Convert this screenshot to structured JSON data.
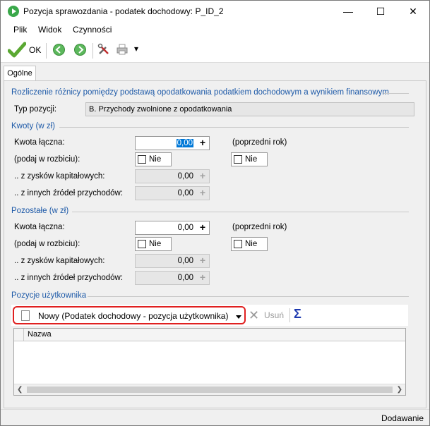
{
  "window": {
    "title": "Pozycja sprawozdania - podatek dochodowy: P_ID_2",
    "minimize": "—",
    "maximize": "☐",
    "close": "✕"
  },
  "menu": [
    "Plik",
    "Widok",
    "Czynności"
  ],
  "toolbar": {
    "ok_label": "OK",
    "dropdown_arrow": "▾"
  },
  "tabs": [
    "Ogólne"
  ],
  "header_section": {
    "title": "Rozliczenie różnicy pomiędzy podstawą opodatkowania podatkiem dochodowym a wynikiem finansowym",
    "type_label": "Typ pozycji:",
    "type_value": "B. Przychody zwolnione z opodatkowania"
  },
  "kwoty": {
    "title": "Kwoty (w zł)",
    "total_label": "Kwota łączna:",
    "total_value": "0,00",
    "prev_year": "(poprzedni rok)",
    "breakdown_label": "(podaj w rozbiciu):",
    "breakdown_value": "Nie",
    "prev_breakdown_value": "Nie",
    "capital_label": ".. z zysków kapitałowych:",
    "capital_value": "0,00",
    "other_label": ".. z innych źródeł przychodów:",
    "other_value": "0,00"
  },
  "pozostale": {
    "title": "Pozostałe (w zł)",
    "total_label": "Kwota łączna:",
    "total_value": "0,00",
    "prev_year": "(poprzedni rok)",
    "breakdown_label": "(podaj w rozbiciu):",
    "breakdown_value": "Nie",
    "prev_breakdown_value": "Nie",
    "capital_label": ".. z zysków kapitałowych:",
    "capital_value": "0,00",
    "other_label": ".. z innych źródeł przychodów:",
    "other_value": "0,00"
  },
  "user_items": {
    "title": "Pozycje użytkownika",
    "new_label": "Nowy (Podatek dochodowy - pozycja użytkownika)",
    "delete_label": "Usuń",
    "sigma": "Σ",
    "column_name": "Nazwa"
  },
  "status": "Dodawanie",
  "colors": {
    "section_blue": "#1e5aa8",
    "highlight_red": "#e02020",
    "selection": "#0078d7"
  }
}
